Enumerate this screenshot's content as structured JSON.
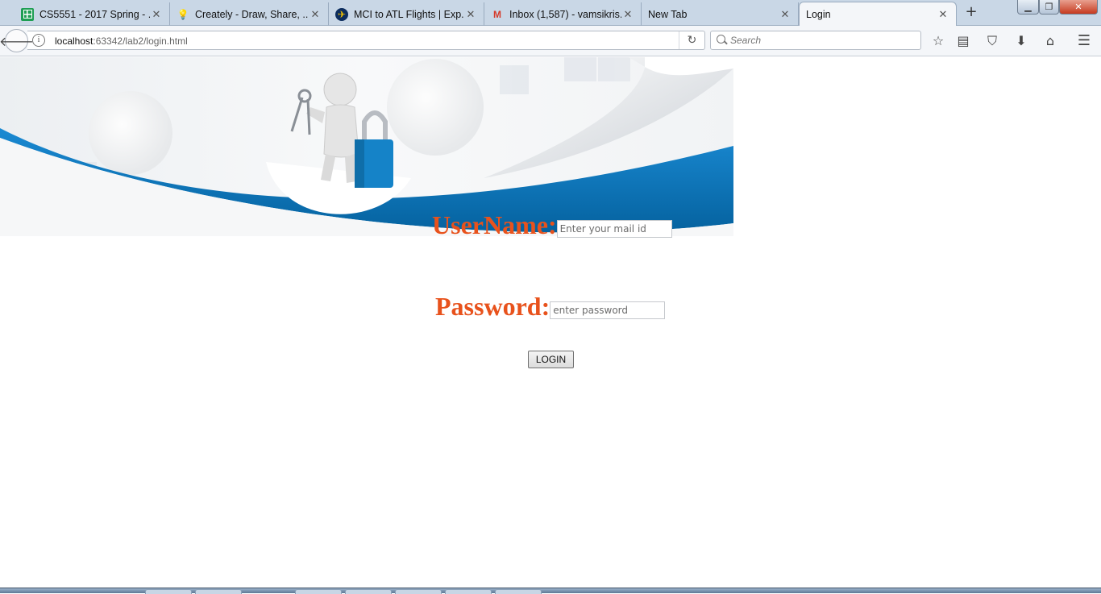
{
  "browser": {
    "tabs": [
      {
        "title": "CS5551 - 2017 Spring - ...",
        "icon": "google-sheets-icon",
        "active": false
      },
      {
        "title": "Creately - Draw, Share, ...",
        "icon": "lightbulb-icon",
        "active": false
      },
      {
        "title": "MCI to ATL Flights | Exp...",
        "icon": "expedia-plane-icon",
        "active": false
      },
      {
        "title": "Inbox (1,587) - vamsikris...",
        "icon": "gmail-icon",
        "active": false
      },
      {
        "title": "New Tab",
        "icon": "",
        "active": false
      },
      {
        "title": "Login",
        "icon": "",
        "active": true
      }
    ],
    "new_tab_label": "+",
    "url": {
      "host": "localhost",
      "rest": ":63342/lab2/login.html"
    },
    "search_placeholder": "Search"
  },
  "page": {
    "username_label": "UserName:",
    "username_placeholder": "Enter your mail id",
    "password_label": "Password:",
    "password_placeholder": "enter password",
    "login_button": "LOGIN"
  },
  "colors": {
    "label": "#e8521c",
    "banner_blue": "#0a7ac2"
  }
}
